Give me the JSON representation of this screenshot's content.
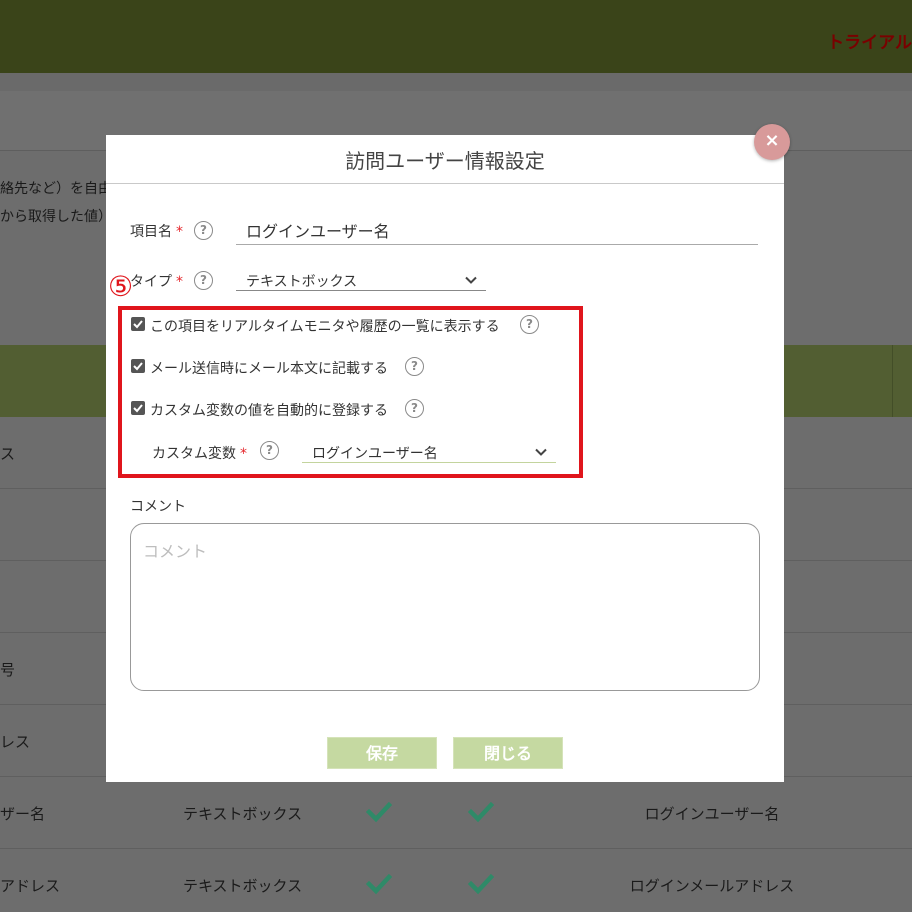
{
  "background": {
    "trial_text": "トライアル",
    "desc_lines": [
      "絡先など）を自由",
      "から取得した値）"
    ],
    "rows": [
      {
        "name": "ス",
        "type": "",
        "value": "",
        "checks": [
          false,
          false
        ]
      },
      {
        "name": "",
        "type": "",
        "value": "",
        "checks": [
          false,
          false
        ]
      },
      {
        "name": "",
        "type": "",
        "value": "",
        "checks": [
          false,
          false
        ]
      },
      {
        "name": "号",
        "type": "",
        "value": "",
        "checks": [
          false,
          false
        ]
      },
      {
        "name": "レス",
        "type": "",
        "value": "",
        "checks": [
          false,
          false
        ]
      },
      {
        "name": "ザー名",
        "type": "テキストボックス",
        "value": "ログインユーザー名",
        "checks": [
          true,
          true
        ]
      },
      {
        "name": "アドレス",
        "type": "テキストボックス",
        "value": "ログインメールアドレス",
        "checks": [
          true,
          true
        ]
      }
    ]
  },
  "modal": {
    "title": "訪問ユーザー情報設定",
    "close_label": "×",
    "item_name": {
      "label": "項目名",
      "required_mark": "*",
      "help": "?",
      "value": "ログインユーザー名"
    },
    "type": {
      "label": "タイプ",
      "required_mark": "*",
      "help": "?",
      "selected": "テキストボックス"
    },
    "annotation_number": "⑤",
    "checkboxes": [
      {
        "label": "この項目をリアルタイムモニタや履歴の一覧に表示する",
        "checked": true,
        "help": "?"
      },
      {
        "label": "メール送信時にメール本文に記載する",
        "checked": true,
        "help": "?"
      },
      {
        "label": "カスタム変数の値を自動的に登録する",
        "checked": true,
        "help": "?"
      }
    ],
    "custom_var": {
      "label": "カスタム変数",
      "required_mark": "*",
      "help": "?",
      "selected": "ログインユーザー名"
    },
    "comment": {
      "label": "コメント",
      "placeholder": "コメント",
      "value": ""
    },
    "buttons": {
      "save": "保存",
      "close": "閉じる"
    }
  },
  "colors": {
    "header_bg": "#3a4419",
    "table_header_bg": "#525e32",
    "accent_red": "#e0151c",
    "check_green": "#2f8a68",
    "button_bg": "#c5d9a1"
  }
}
